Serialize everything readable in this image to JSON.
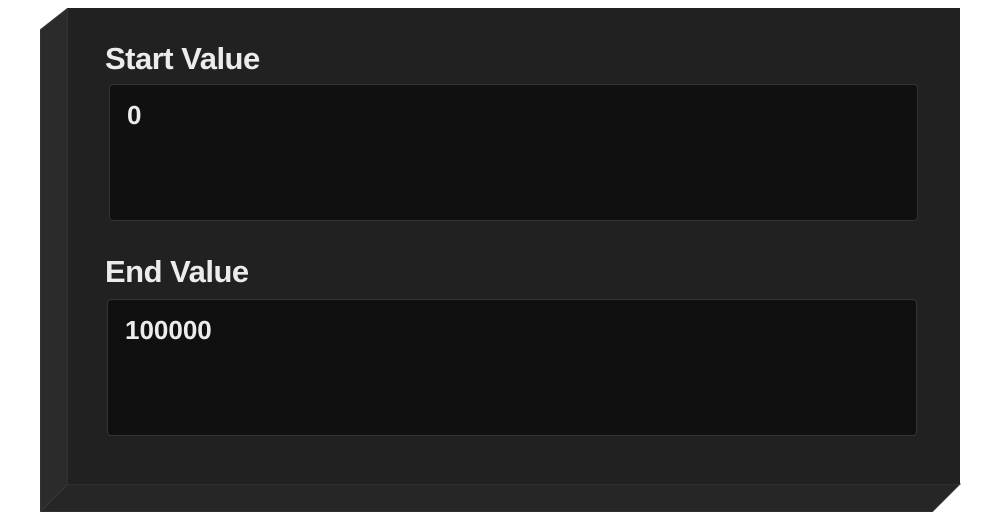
{
  "form": {
    "start": {
      "label": "Start Value",
      "value": "0"
    },
    "end": {
      "label": "End Value",
      "value": "100000"
    }
  },
  "colors": {
    "panel_face": "#212121",
    "panel_side": "#2c2c2c",
    "panel_bottom": "#262626",
    "input_bg": "#101010",
    "text": "#ececec"
  }
}
